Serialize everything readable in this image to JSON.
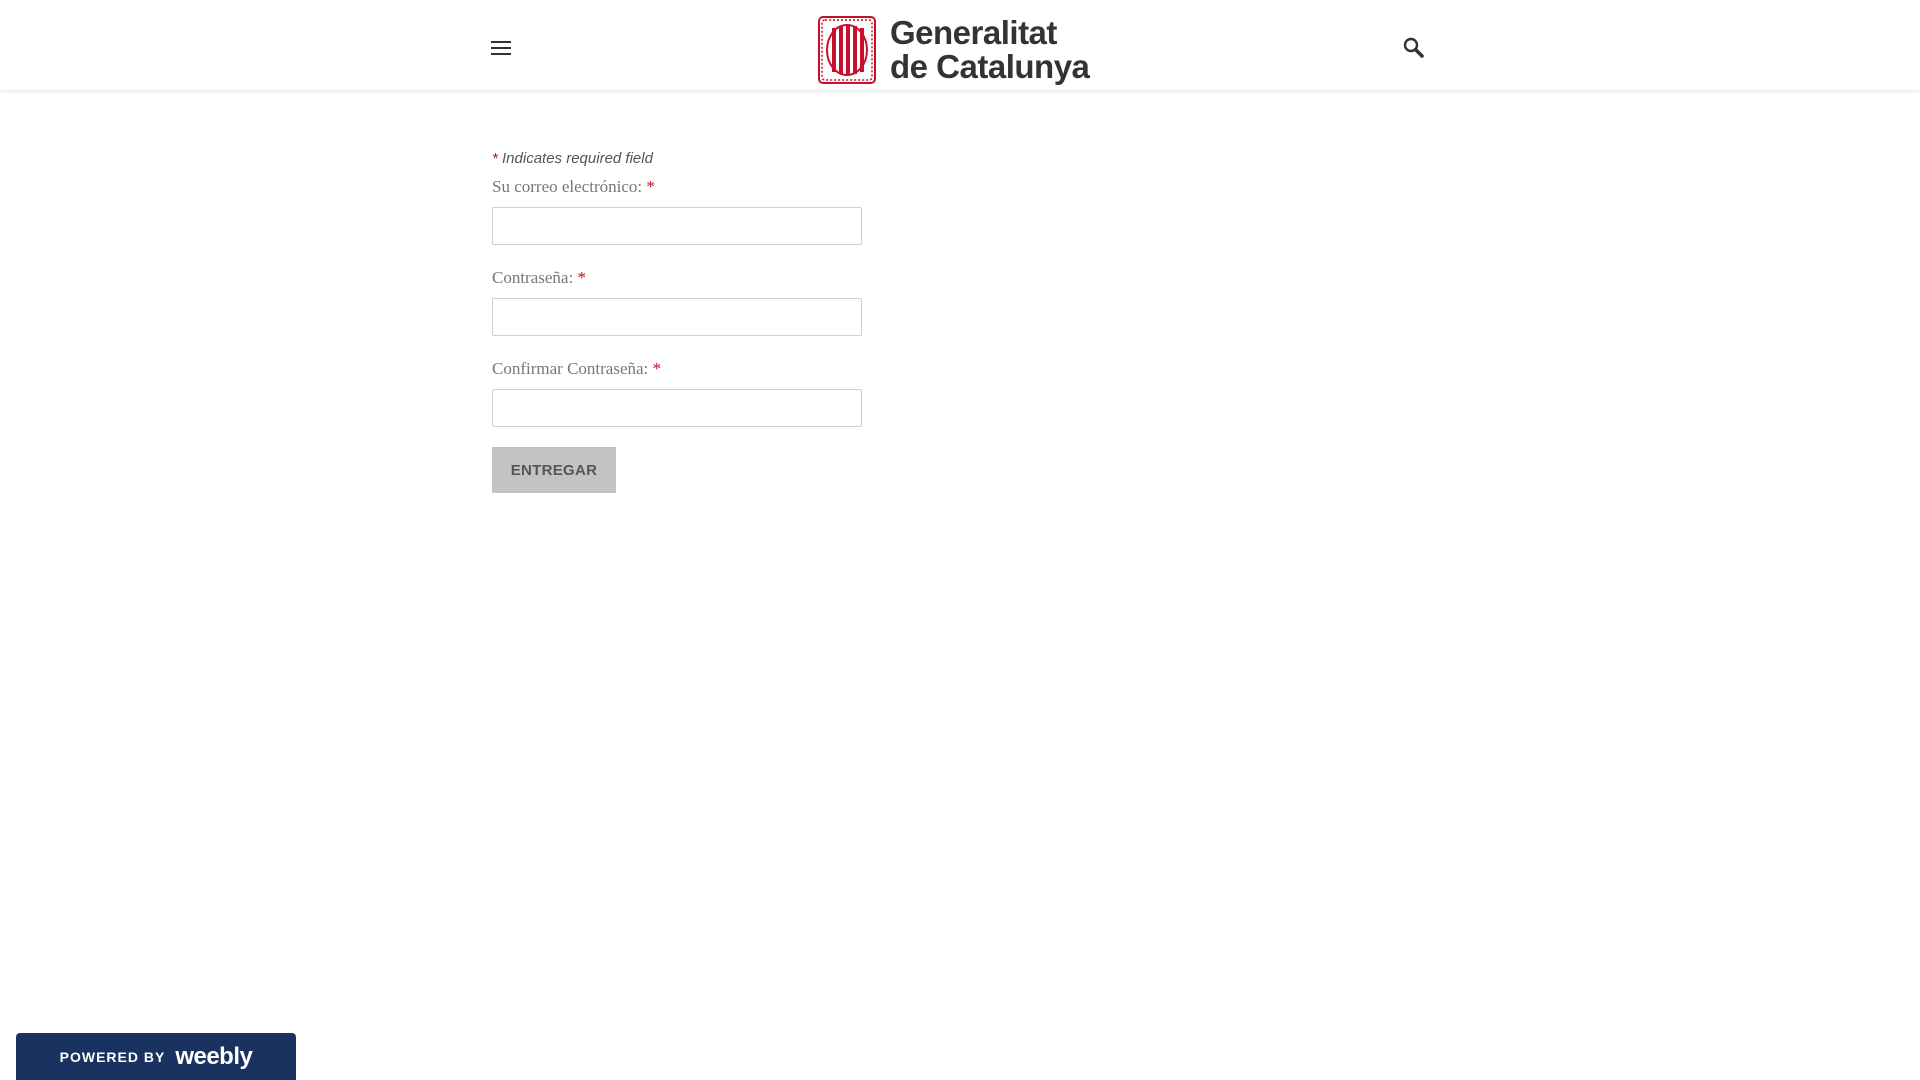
{
  "header": {
    "menu_icon": "hamburger-menu-icon",
    "logo_line1": "Generalitat",
    "logo_line2": "de Catalunya",
    "search_icon": "search-icon",
    "logo_color": "#c8102e"
  },
  "form": {
    "required_note_star": "*",
    "required_note_text": " Indicates required field",
    "fields": [
      {
        "label": "Su correo electrónico:",
        "star": "*",
        "value": ""
      },
      {
        "label": "Contraseña:",
        "star": "*",
        "value": ""
      },
      {
        "label": "Confirmar Contraseña:",
        "star": "*",
        "value": ""
      }
    ],
    "submit_label": "ENTREGAR"
  },
  "footer_badge": {
    "powered_label": "POWERED BY",
    "brand_label": "weebly"
  }
}
